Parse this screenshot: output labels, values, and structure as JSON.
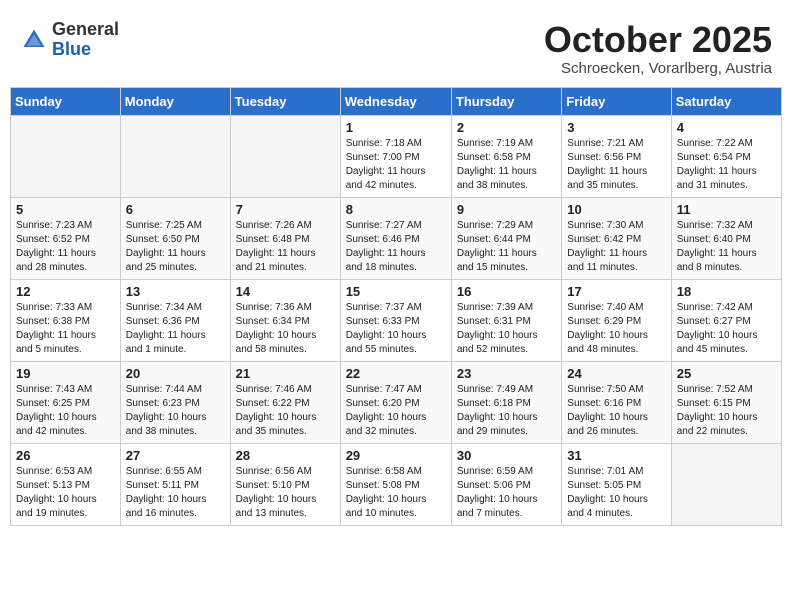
{
  "header": {
    "logo_general": "General",
    "logo_blue": "Blue",
    "month_title": "October 2025",
    "subtitle": "Schroecken, Vorarlberg, Austria"
  },
  "days_of_week": [
    "Sunday",
    "Monday",
    "Tuesday",
    "Wednesday",
    "Thursday",
    "Friday",
    "Saturday"
  ],
  "weeks": [
    [
      {
        "day": "",
        "info": ""
      },
      {
        "day": "",
        "info": ""
      },
      {
        "day": "",
        "info": ""
      },
      {
        "day": "1",
        "info": "Sunrise: 7:18 AM\nSunset: 7:00 PM\nDaylight: 11 hours\nand 42 minutes."
      },
      {
        "day": "2",
        "info": "Sunrise: 7:19 AM\nSunset: 6:58 PM\nDaylight: 11 hours\nand 38 minutes."
      },
      {
        "day": "3",
        "info": "Sunrise: 7:21 AM\nSunset: 6:56 PM\nDaylight: 11 hours\nand 35 minutes."
      },
      {
        "day": "4",
        "info": "Sunrise: 7:22 AM\nSunset: 6:54 PM\nDaylight: 11 hours\nand 31 minutes."
      }
    ],
    [
      {
        "day": "5",
        "info": "Sunrise: 7:23 AM\nSunset: 6:52 PM\nDaylight: 11 hours\nand 28 minutes."
      },
      {
        "day": "6",
        "info": "Sunrise: 7:25 AM\nSunset: 6:50 PM\nDaylight: 11 hours\nand 25 minutes."
      },
      {
        "day": "7",
        "info": "Sunrise: 7:26 AM\nSunset: 6:48 PM\nDaylight: 11 hours\nand 21 minutes."
      },
      {
        "day": "8",
        "info": "Sunrise: 7:27 AM\nSunset: 6:46 PM\nDaylight: 11 hours\nand 18 minutes."
      },
      {
        "day": "9",
        "info": "Sunrise: 7:29 AM\nSunset: 6:44 PM\nDaylight: 11 hours\nand 15 minutes."
      },
      {
        "day": "10",
        "info": "Sunrise: 7:30 AM\nSunset: 6:42 PM\nDaylight: 11 hours\nand 11 minutes."
      },
      {
        "day": "11",
        "info": "Sunrise: 7:32 AM\nSunset: 6:40 PM\nDaylight: 11 hours\nand 8 minutes."
      }
    ],
    [
      {
        "day": "12",
        "info": "Sunrise: 7:33 AM\nSunset: 6:38 PM\nDaylight: 11 hours\nand 5 minutes."
      },
      {
        "day": "13",
        "info": "Sunrise: 7:34 AM\nSunset: 6:36 PM\nDaylight: 11 hours\nand 1 minute."
      },
      {
        "day": "14",
        "info": "Sunrise: 7:36 AM\nSunset: 6:34 PM\nDaylight: 10 hours\nand 58 minutes."
      },
      {
        "day": "15",
        "info": "Sunrise: 7:37 AM\nSunset: 6:33 PM\nDaylight: 10 hours\nand 55 minutes."
      },
      {
        "day": "16",
        "info": "Sunrise: 7:39 AM\nSunset: 6:31 PM\nDaylight: 10 hours\nand 52 minutes."
      },
      {
        "day": "17",
        "info": "Sunrise: 7:40 AM\nSunset: 6:29 PM\nDaylight: 10 hours\nand 48 minutes."
      },
      {
        "day": "18",
        "info": "Sunrise: 7:42 AM\nSunset: 6:27 PM\nDaylight: 10 hours\nand 45 minutes."
      }
    ],
    [
      {
        "day": "19",
        "info": "Sunrise: 7:43 AM\nSunset: 6:25 PM\nDaylight: 10 hours\nand 42 minutes."
      },
      {
        "day": "20",
        "info": "Sunrise: 7:44 AM\nSunset: 6:23 PM\nDaylight: 10 hours\nand 38 minutes."
      },
      {
        "day": "21",
        "info": "Sunrise: 7:46 AM\nSunset: 6:22 PM\nDaylight: 10 hours\nand 35 minutes."
      },
      {
        "day": "22",
        "info": "Sunrise: 7:47 AM\nSunset: 6:20 PM\nDaylight: 10 hours\nand 32 minutes."
      },
      {
        "day": "23",
        "info": "Sunrise: 7:49 AM\nSunset: 6:18 PM\nDaylight: 10 hours\nand 29 minutes."
      },
      {
        "day": "24",
        "info": "Sunrise: 7:50 AM\nSunset: 6:16 PM\nDaylight: 10 hours\nand 26 minutes."
      },
      {
        "day": "25",
        "info": "Sunrise: 7:52 AM\nSunset: 6:15 PM\nDaylight: 10 hours\nand 22 minutes."
      }
    ],
    [
      {
        "day": "26",
        "info": "Sunrise: 6:53 AM\nSunset: 5:13 PM\nDaylight: 10 hours\nand 19 minutes."
      },
      {
        "day": "27",
        "info": "Sunrise: 6:55 AM\nSunset: 5:11 PM\nDaylight: 10 hours\nand 16 minutes."
      },
      {
        "day": "28",
        "info": "Sunrise: 6:56 AM\nSunset: 5:10 PM\nDaylight: 10 hours\nand 13 minutes."
      },
      {
        "day": "29",
        "info": "Sunrise: 6:58 AM\nSunset: 5:08 PM\nDaylight: 10 hours\nand 10 minutes."
      },
      {
        "day": "30",
        "info": "Sunrise: 6:59 AM\nSunset: 5:06 PM\nDaylight: 10 hours\nand 7 minutes."
      },
      {
        "day": "31",
        "info": "Sunrise: 7:01 AM\nSunset: 5:05 PM\nDaylight: 10 hours\nand 4 minutes."
      },
      {
        "day": "",
        "info": ""
      }
    ]
  ]
}
